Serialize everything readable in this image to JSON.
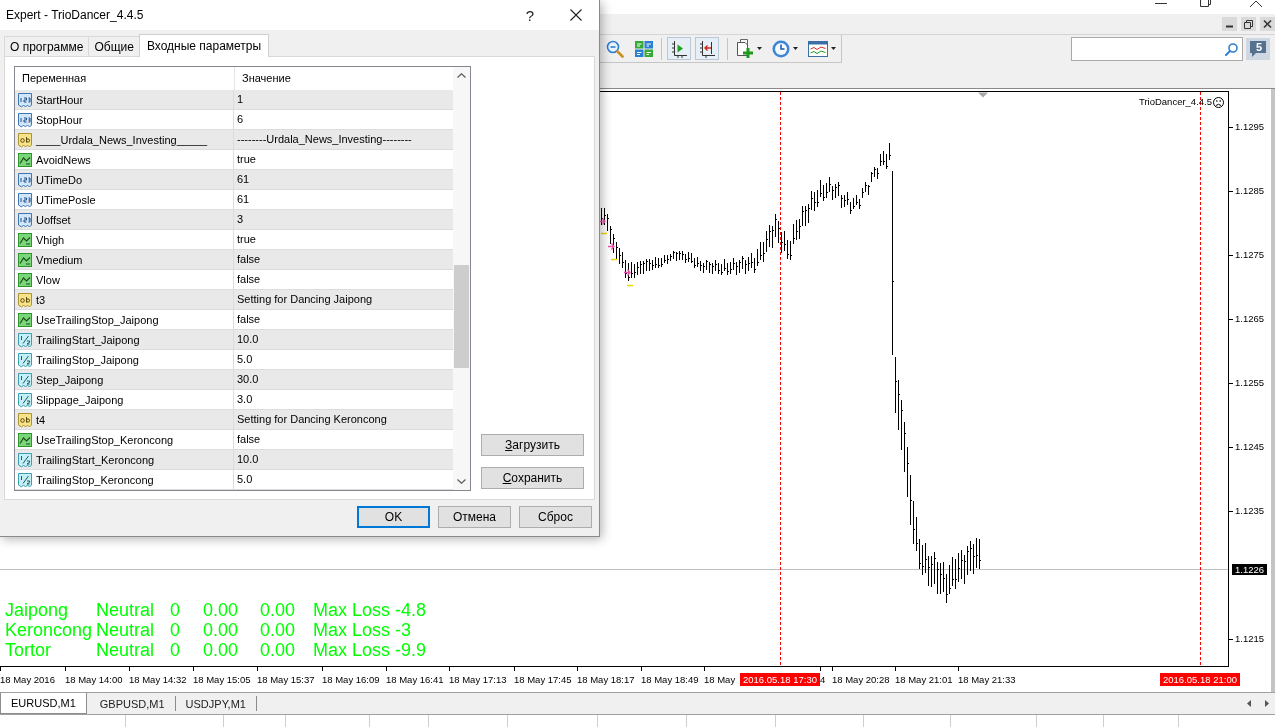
{
  "dialog": {
    "title": "Expert - TrioDancer_4.4.5",
    "help": "?",
    "tabs": [
      {
        "label": "О программе",
        "selected": false
      },
      {
        "label": "Общие",
        "selected": false
      },
      {
        "label": "Входные параметры",
        "selected": true
      }
    ],
    "columns": [
      "Переменная",
      "Значение"
    ],
    "parameters": [
      {
        "kind": "int",
        "name": "StartHour",
        "value": "1"
      },
      {
        "kind": "int",
        "name": "StopHour",
        "value": "6"
      },
      {
        "kind": "string",
        "name": "____Urdala_News_Investing_____",
        "value": "--------Urdala_News_Investing--------"
      },
      {
        "kind": "bool",
        "name": "AvoidNews",
        "value": "true"
      },
      {
        "kind": "int",
        "name": "UTimeDo",
        "value": "61"
      },
      {
        "kind": "int",
        "name": "UTimePosle",
        "value": "61"
      },
      {
        "kind": "int",
        "name": "Uoffset",
        "value": "3"
      },
      {
        "kind": "bool",
        "name": "Vhigh",
        "value": "true"
      },
      {
        "kind": "bool",
        "name": "Vmedium",
        "value": "false"
      },
      {
        "kind": "bool",
        "name": "Vlow",
        "value": "false"
      },
      {
        "kind": "string",
        "name": "t3",
        "value": "Setting for Dancing Jaipong"
      },
      {
        "kind": "bool",
        "name": "UseTrailingStop_Jaipong",
        "value": "false"
      },
      {
        "kind": "double",
        "name": "TrailingStart_Jaipong",
        "value": "10.0"
      },
      {
        "kind": "double",
        "name": "TrailingStop_Jaipong",
        "value": "5.0"
      },
      {
        "kind": "double",
        "name": "Step_Jaipong",
        "value": "30.0"
      },
      {
        "kind": "double",
        "name": "Slippage_Jaipong",
        "value": "3.0"
      },
      {
        "kind": "string",
        "name": "t4",
        "value": "Setting for Dancing Keroncong"
      },
      {
        "kind": "bool",
        "name": "UseTrailingStop_Keroncong",
        "value": "false"
      },
      {
        "kind": "double",
        "name": "TrailingStart_Keroncong",
        "value": "10.0"
      },
      {
        "kind": "double",
        "name": "TrailingStop_Keroncong",
        "value": "5.0"
      }
    ],
    "side_buttons": [
      "Загрузить",
      "Сохранить"
    ],
    "buttons": [
      {
        "label": "OK",
        "default": true
      },
      {
        "label": "Отмена",
        "default": false
      },
      {
        "label": "Сброс",
        "default": false
      }
    ]
  },
  "terminal": {
    "toolbar": {
      "chart_shift": {
        "on": true
      },
      "auto_scroll": {
        "on": true
      }
    },
    "notifications": "5",
    "chart": {
      "expert": "TrioDancer_4.4.5",
      "trading_enabled": false,
      "price_labels": [
        "1.1295",
        "1.1285",
        "1.1275",
        "1.1265",
        "1.1255",
        "1.1245",
        "1.1235",
        "1.1215"
      ],
      "bid": "1.1226",
      "time_labels": [
        "18 May 2016",
        "18 May 14:00",
        "18 May 14:32",
        "18 May 15:05",
        "18 May 15:37",
        "18 May 16:09",
        "18 May 16:41",
        "18 May 17:13",
        "18 May 17:45",
        "18 May 18:17",
        "18 May 18:49",
        "18 May",
        "4",
        "18 May 20:28",
        "18 May 21:01",
        "18 May 21:33"
      ],
      "events": [
        "2016.05.18 17:30",
        "2016.05.18 21:00"
      ],
      "status_lines": [
        {
          "name": "Jaipong",
          "state": "Neutral",
          "count": "0",
          "value_1": "0.00",
          "value_2": "0.00",
          "max_loss": "Max Loss -4.8"
        },
        {
          "name": "Keroncong",
          "state": "Neutral",
          "count": "0",
          "value_1": "0.00",
          "value_2": "0.00",
          "max_loss": "Max Loss -3"
        },
        {
          "name": "Tortor",
          "state": "Neutral",
          "count": "0",
          "value_1": "0.00",
          "value_2": "0.00",
          "max_loss": "Max Loss -9.9"
        }
      ]
    },
    "chart_tabs": [
      {
        "label": "EURUSD,M1",
        "selected": true
      },
      {
        "label": "GBPUSD,M1",
        "selected": false
      },
      {
        "label": "USDJPY,M1",
        "selected": false
      }
    ]
  }
}
